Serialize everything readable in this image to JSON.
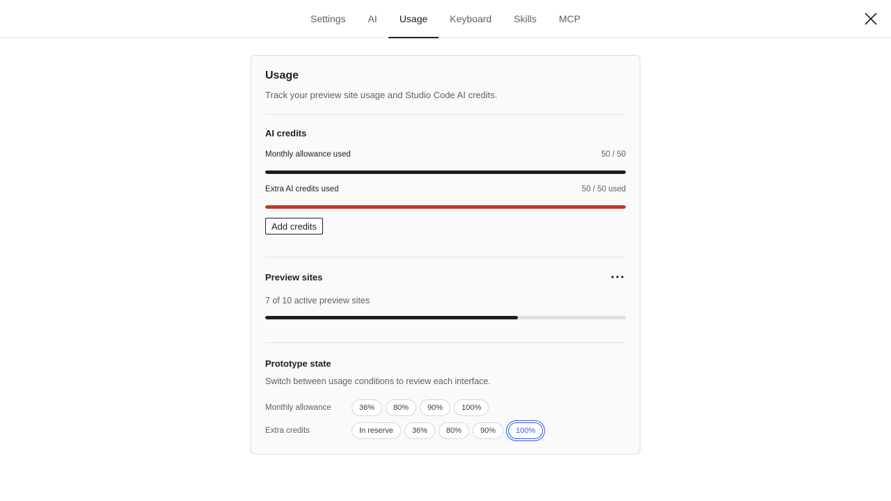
{
  "tabs": [
    {
      "label": "Settings",
      "active": false
    },
    {
      "label": "AI",
      "active": false
    },
    {
      "label": "Usage",
      "active": true
    },
    {
      "label": "Keyboard",
      "active": false
    },
    {
      "label": "Skills",
      "active": false
    },
    {
      "label": "MCP",
      "active": false
    }
  ],
  "close_icon": "close-icon",
  "panel": {
    "title": "Usage",
    "description": "Track your preview site usage and Studio Code AI credits."
  },
  "ai_credits": {
    "title": "AI credits",
    "monthly": {
      "label": "Monthly allowance used",
      "value_text": "50 / 50",
      "fraction": 1.0,
      "color": "#1e1e1e"
    },
    "extra": {
      "label": "Extra AI credits used",
      "value_text": "50 / 50 used",
      "fraction": 1.0,
      "color": "#c0392b"
    },
    "add_button": "Add credits"
  },
  "preview_sites": {
    "title": "Preview sites",
    "more_icon": "more-horizontal-icon",
    "description": "7 of 10 active preview sites",
    "fraction": 0.7,
    "color": "#1e1e1e"
  },
  "prototype": {
    "title": "Prototype state",
    "description": "Switch between usage conditions to review each interface.",
    "monthly": {
      "label": "Monthly allowance",
      "options": [
        "36%",
        "80%",
        "90%",
        "100%"
      ],
      "selected": null
    },
    "extra": {
      "label": "Extra credits",
      "options": [
        "In reserve",
        "36%",
        "80%",
        "90%",
        "100%"
      ],
      "selected": "100%"
    }
  },
  "colors": {
    "accent": "#3858e9",
    "danger": "#c0392b",
    "text": "#1e1e1e",
    "muted": "#5f5f5f"
  }
}
